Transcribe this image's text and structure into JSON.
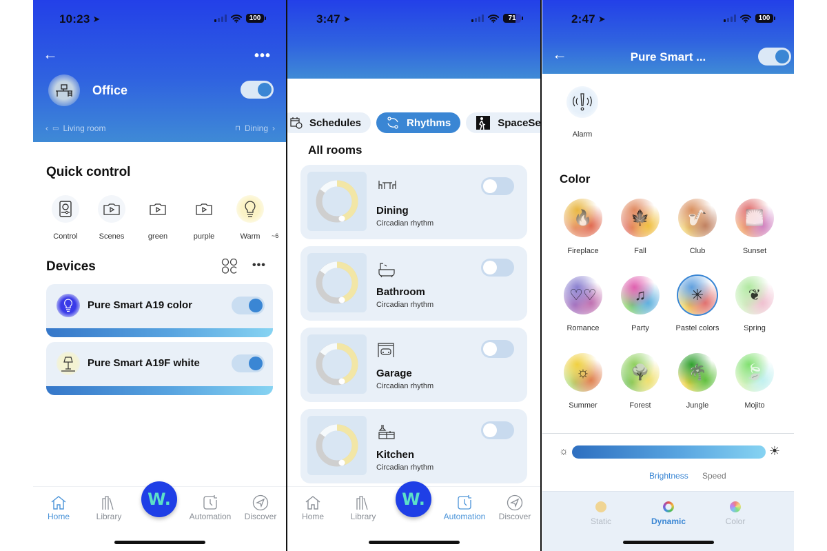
{
  "phones": [
    {
      "status": {
        "time": "10:23",
        "battery": "100"
      },
      "header": {
        "room_title": "Office",
        "room_toggle_on": true,
        "prev_room": "Living room",
        "next_room": "Dining"
      },
      "quick_control": {
        "title": "Quick control",
        "items": [
          {
            "label": "Control",
            "icon": "remote-icon"
          },
          {
            "label": "Scenes",
            "icon": "scene-play-icon"
          },
          {
            "label": "green",
            "icon": "scene-play-icon"
          },
          {
            "label": "purple",
            "icon": "scene-play-icon"
          },
          {
            "label": "Warm",
            "icon": "bulb-icon"
          },
          {
            "label": "~6",
            "icon": "partial-icon"
          }
        ]
      },
      "devices": {
        "title": "Devices",
        "items": [
          {
            "name": "Pure Smart A19 color",
            "on": true,
            "icon": "color-bulb-icon"
          },
          {
            "name": "Pure Smart A19F white",
            "on": true,
            "icon": "lamp-icon"
          }
        ]
      },
      "tabbar": {
        "items": [
          "Home",
          "Library",
          "Automation",
          "Discover"
        ],
        "active": "Home",
        "fab_label": "W."
      }
    },
    {
      "status": {
        "time": "3:47",
        "battery": "71"
      },
      "chips": [
        {
          "label": "Schedules",
          "icon": "schedule-icon",
          "active": false
        },
        {
          "label": "Rhythms",
          "icon": "rhythm-icon",
          "active": true
        },
        {
          "label": "SpaceSen",
          "icon": "spacesense-icon",
          "active": false
        }
      ],
      "section_title": "All rooms",
      "rooms": [
        {
          "name": "Dining",
          "subtitle": "Circadian rhythm",
          "on": false,
          "icon": "dining-table-icon"
        },
        {
          "name": "Bathroom",
          "subtitle": "Circadian rhythm",
          "on": false,
          "icon": "bathtub-icon"
        },
        {
          "name": "Garage",
          "subtitle": "Circadian rhythm",
          "on": false,
          "icon": "garage-car-icon"
        },
        {
          "name": "Kitchen",
          "subtitle": "Circadian rhythm",
          "on": false,
          "icon": "kitchen-icon"
        }
      ],
      "tabbar": {
        "items": [
          "Home",
          "Library",
          "Automation",
          "Discover"
        ],
        "active": "Automation",
        "fab_label": "W."
      }
    },
    {
      "status": {
        "time": "2:47",
        "battery": "100"
      },
      "header": {
        "title": "Pure Smart ...",
        "toggle_on": true
      },
      "alarm": {
        "label": "Alarm"
      },
      "color_section": {
        "title": "Color",
        "scenes": [
          {
            "label": "Fireplace",
            "colors": [
              "#e8b640",
              "#e06a50",
              "#e89a70"
            ]
          },
          {
            "label": "Fall",
            "colors": [
              "#e08a60",
              "#f0c040",
              "#e07060"
            ]
          },
          {
            "label": "Club",
            "colors": [
              "#d99060",
              "#c08060",
              "#f0d070"
            ]
          },
          {
            "label": "Sunset",
            "colors": [
              "#e07070",
              "#d080c0",
              "#f0a060"
            ]
          },
          {
            "label": "Romance",
            "colors": [
              "#8a80d0",
              "#c070b0",
              "#a070c0"
            ]
          },
          {
            "label": "Party",
            "colors": [
              "#e060b0",
              "#60b0e0",
              "#80d060"
            ]
          },
          {
            "label": "Pastel colors",
            "colors": [
              "#60a0e0",
              "#e07070",
              "#f0d050"
            ],
            "selected": true
          },
          {
            "label": "Spring",
            "colors": [
              "#b0e8a0",
              "#f0c0d0",
              "#d0f0c0"
            ]
          },
          {
            "label": "Summer",
            "colors": [
              "#f0d040",
              "#e08050",
              "#b0d870"
            ]
          },
          {
            "label": "Forest",
            "colors": [
              "#90d060",
              "#f0e070",
              "#70c050"
            ]
          },
          {
            "label": "Jungle",
            "colors": [
              "#30a030",
              "#60c040",
              "#f0d040"
            ]
          },
          {
            "label": "Mojito",
            "colors": [
              "#80e070",
              "#c0f0f0",
              "#d0f0b0"
            ]
          }
        ]
      },
      "slider": {
        "brightness_percent": 100,
        "tabs": [
          "Brightness",
          "Speed"
        ],
        "active_tab": "Brightness"
      },
      "modes": {
        "items": [
          "Static",
          "Dynamic",
          "Color"
        ],
        "active": "Dynamic"
      }
    }
  ]
}
